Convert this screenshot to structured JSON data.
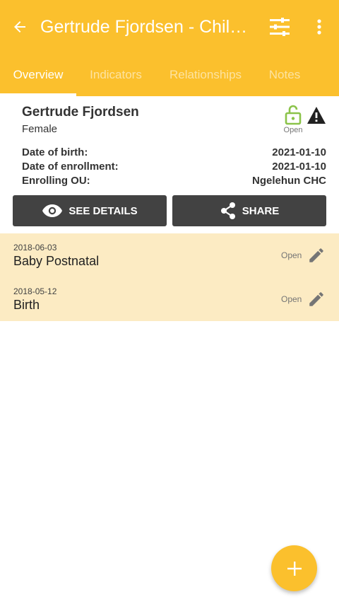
{
  "toolbar": {
    "title": "Gertrude Fjordsen - Child Programme",
    "back_icon": "arrow-back-icon",
    "filter_icon": "filter-list-icon",
    "menu_icon": "more-vert-icon"
  },
  "tabs": [
    {
      "label": "Overview",
      "active": true
    },
    {
      "label": "Indicators",
      "active": false
    },
    {
      "label": "Relationships",
      "active": false
    },
    {
      "label": "Notes",
      "active": false
    }
  ],
  "profile": {
    "name": "Gertrude Fjordsen",
    "sex": "Female",
    "enrollment_status": "Open",
    "date_of_birth_label": "Date of birth:",
    "date_of_birth": "2021-01-10",
    "enrollment_date_label": "Date of enrollment:",
    "enrollment_date": "2021-01-10",
    "ou_label": "Enrolling OU:",
    "ou": "Ngelehun CHC"
  },
  "actions": {
    "see_details": "SEE DETAILS",
    "share": "SHARE"
  },
  "events": [
    {
      "date": "2018-06-03",
      "name": "Baby Postnatal",
      "status": "Open"
    },
    {
      "date": "2018-05-12",
      "name": "Birth",
      "status": "Open"
    }
  ],
  "colors": {
    "primary": "#fbc02d",
    "event_bg": "#fcebc3",
    "button_dark": "#424242",
    "lock_open": "#8bc34a"
  },
  "fab_label": "+"
}
